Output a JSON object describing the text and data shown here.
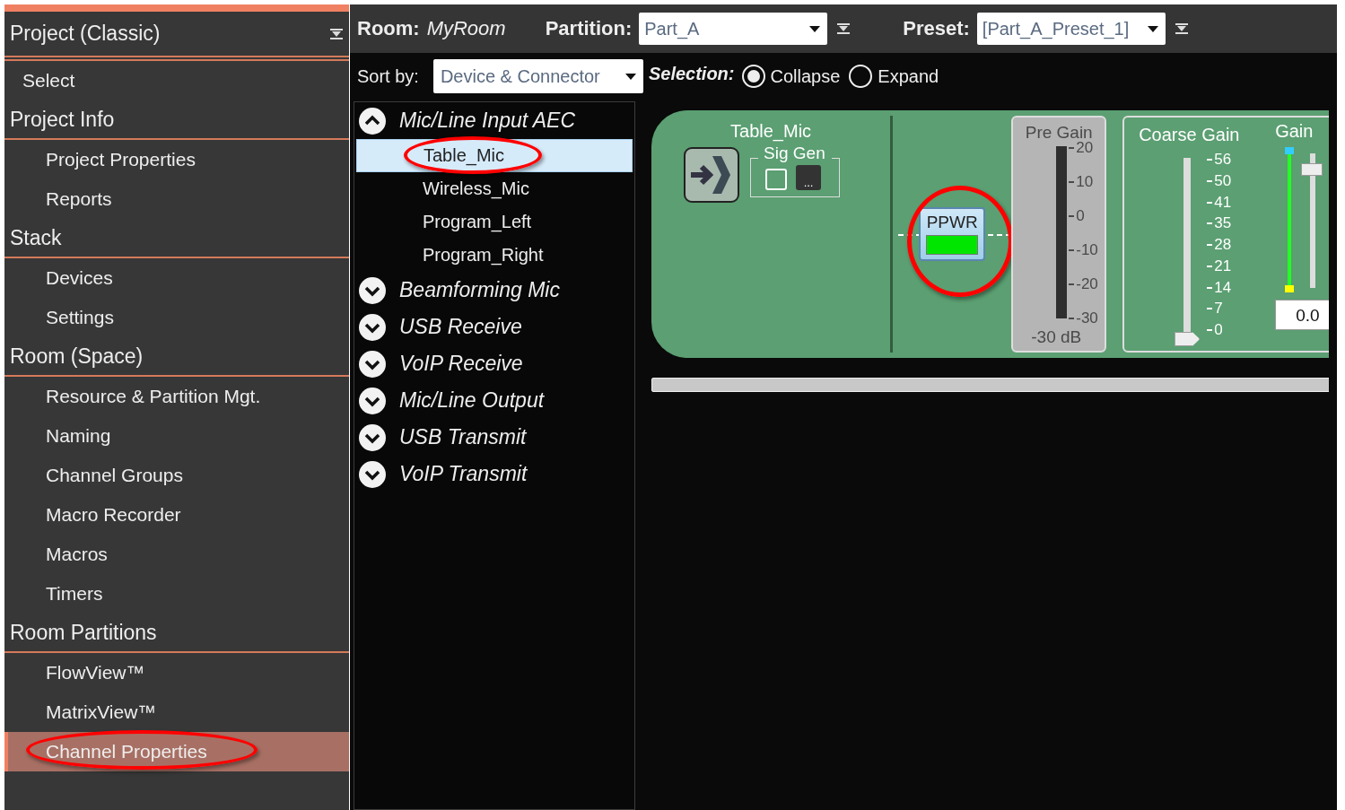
{
  "sidebar": {
    "title": "Project (Classic)",
    "items": [
      {
        "kind": "top",
        "label": "Select",
        "selected": false,
        "circled": false
      },
      {
        "kind": "header",
        "label": "Project Info",
        "selected": false,
        "circled": false
      },
      {
        "kind": "sub",
        "label": "Project Properties",
        "selected": false,
        "circled": false
      },
      {
        "kind": "sub",
        "label": "Reports",
        "selected": false,
        "circled": false
      },
      {
        "kind": "header",
        "label": "Stack",
        "selected": false,
        "circled": false
      },
      {
        "kind": "sub",
        "label": "Devices",
        "selected": false,
        "circled": false
      },
      {
        "kind": "sub",
        "label": "Settings",
        "selected": false,
        "circled": false
      },
      {
        "kind": "header",
        "label": "Room (Space)",
        "selected": false,
        "circled": false
      },
      {
        "kind": "sub",
        "label": "Resource & Partition Mgt.",
        "selected": false,
        "circled": false
      },
      {
        "kind": "sub",
        "label": "Naming",
        "selected": false,
        "circled": false
      },
      {
        "kind": "sub",
        "label": "Channel Groups",
        "selected": false,
        "circled": false
      },
      {
        "kind": "sub",
        "label": "Macro Recorder",
        "selected": false,
        "circled": false
      },
      {
        "kind": "sub",
        "label": "Macros",
        "selected": false,
        "circled": false
      },
      {
        "kind": "sub",
        "label": "Timers",
        "selected": false,
        "circled": false
      },
      {
        "kind": "header",
        "label": "Room Partitions",
        "selected": false,
        "circled": false
      },
      {
        "kind": "sub",
        "label": "FlowView™",
        "selected": false,
        "circled": false
      },
      {
        "kind": "sub",
        "label": "MatrixView™",
        "selected": false,
        "circled": false
      },
      {
        "kind": "sub",
        "label": "Channel Properties",
        "selected": true,
        "circled": true
      }
    ]
  },
  "topbar": {
    "room_label": "Room:",
    "room_name": "MyRoom",
    "partition_label": "Partition:",
    "partition_value": "Part_A",
    "preset_label": "Preset:",
    "preset_value": "[Part_A_Preset_1]"
  },
  "sort": {
    "label": "Sort by:",
    "value": "Device & Connector"
  },
  "selection": {
    "label": "Selection:",
    "options": [
      {
        "label": "Collapse",
        "selected": true
      },
      {
        "label": "Expand",
        "selected": false
      }
    ]
  },
  "tree": [
    {
      "label": "Mic/Line Input AEC",
      "expanded": true,
      "children": [
        {
          "label": "Table_Mic",
          "selected": true,
          "circled": true
        },
        {
          "label": "Wireless_Mic",
          "selected": false,
          "circled": false
        },
        {
          "label": "Program_Left",
          "selected": false,
          "circled": false
        },
        {
          "label": "Program_Right",
          "selected": false,
          "circled": false
        }
      ]
    },
    {
      "label": "Beamforming Mic",
      "expanded": false
    },
    {
      "label": "USB Receive",
      "expanded": false
    },
    {
      "label": "VoIP Receive",
      "expanded": false
    },
    {
      "label": "Mic/Line Output",
      "expanded": false
    },
    {
      "label": "USB Transmit",
      "expanded": false
    },
    {
      "label": "VoIP Transmit",
      "expanded": false
    }
  ],
  "channel": {
    "name": "Table_Mic",
    "sig_gen": {
      "label": "Sig Gen",
      "checked": false,
      "more": "..."
    },
    "ppwr": {
      "label": "PPWR",
      "on": true,
      "circled": true
    },
    "pre_gain": {
      "label": "Pre Gain",
      "disabled": true,
      "scale": [
        "20",
        "10",
        "0",
        "-10",
        "-20",
        "-30"
      ],
      "reading": "-30 dB"
    },
    "coarse_gain": {
      "label": "Coarse Gain",
      "scale": [
        "56",
        "50",
        "41",
        "35",
        "28",
        "21",
        "14",
        "7",
        "0"
      ],
      "level": 0
    },
    "gain": {
      "label": "Gain",
      "level": 0.85,
      "value": "0.0"
    }
  }
}
